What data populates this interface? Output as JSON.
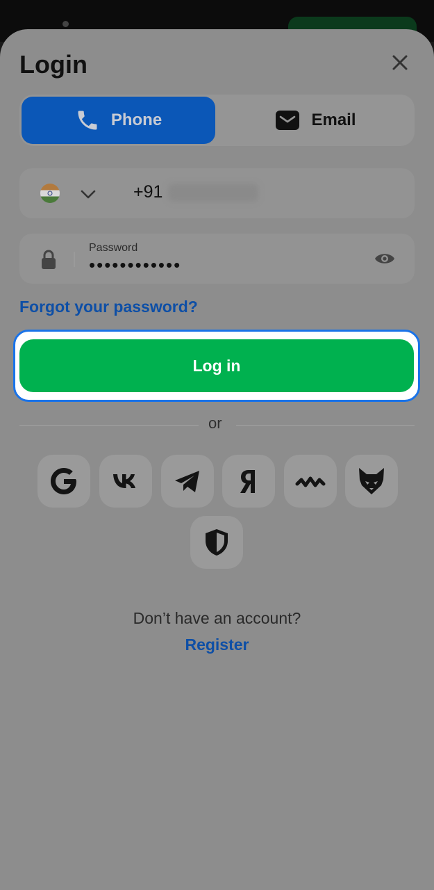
{
  "header": {
    "title": "Login"
  },
  "tabs": [
    {
      "label": "Phone",
      "icon": "phone-icon",
      "active": true
    },
    {
      "label": "Email",
      "icon": "mail-icon",
      "active": false
    }
  ],
  "phone": {
    "country_icon": "india-flag-icon",
    "prefix": "+91"
  },
  "password": {
    "label": "Password",
    "value": "••••••••••••"
  },
  "forgot_label": "Forgot your password?",
  "login_label": "Log in",
  "or_label": "or",
  "social": [
    "google-icon",
    "vk-icon",
    "telegram-icon",
    "yandex-icon",
    "walletconnect-icon",
    "fox-icon",
    "shield-icon"
  ],
  "register": {
    "question": "Don’t have an account?",
    "link": "Register"
  },
  "colors": {
    "primary_blue": "#0b57b7",
    "login_green": "#00b14f",
    "link_blue": "#0e4fa6",
    "focus_ring": "#1a73e8"
  }
}
